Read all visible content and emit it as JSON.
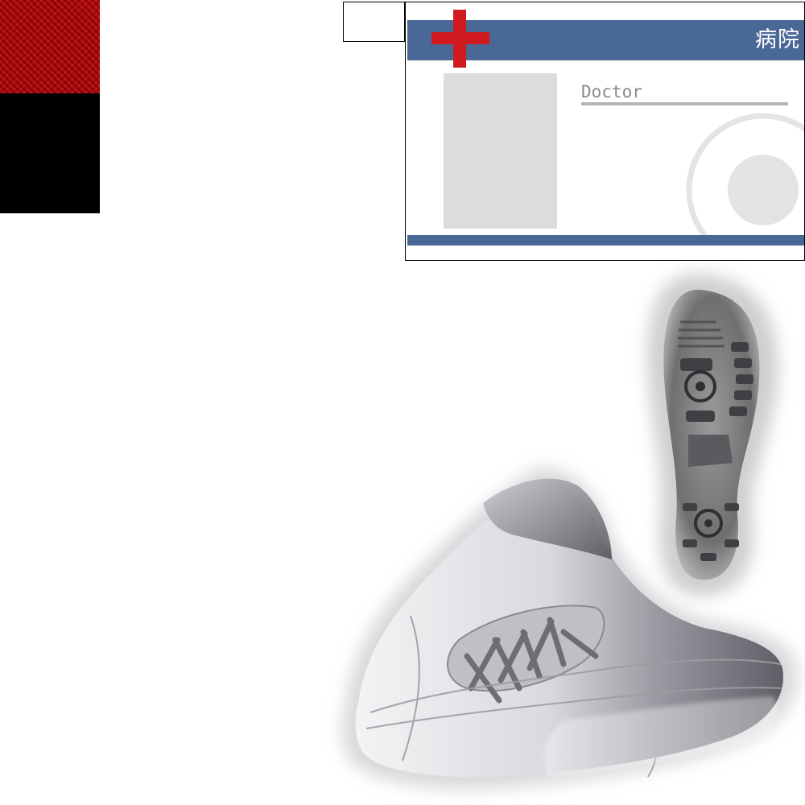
{
  "swatches": {
    "top_color": "#b3090c",
    "bottom_color": "#000000"
  },
  "id_card": {
    "header_title": "病院",
    "role_label": "Doctor",
    "header_color": "#4a6896",
    "cross_color": "#d01a1f",
    "icons": [
      "red-cross-icon",
      "seal-icon"
    ]
  },
  "illustration": {
    "subject": "shoe-icon"
  }
}
